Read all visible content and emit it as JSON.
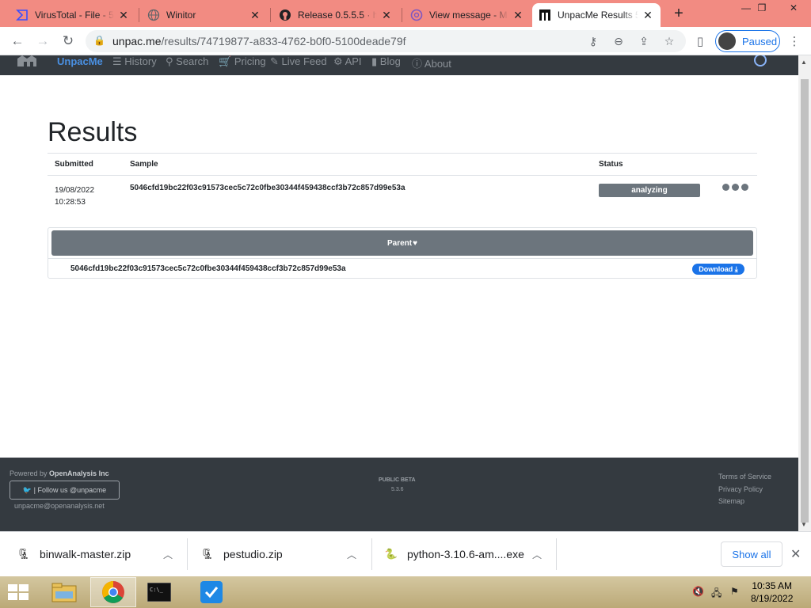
{
  "tabs": [
    {
      "title": "VirusTotal - File - 5",
      "icon": "virustotal-icon"
    },
    {
      "title": "Winitor",
      "icon": "globe-icon"
    },
    {
      "title": "Release 0.5.5.5 · ha",
      "icon": "github-icon"
    },
    {
      "title": "View message - M",
      "icon": "mail-icon"
    },
    {
      "title": "UnpacMe Results 5",
      "icon": "unpacme-icon",
      "active": true
    }
  ],
  "address": {
    "host": "unpac.me",
    "path": "/results/74719877-a833-4762-b0f0-5100deade79f"
  },
  "profile": {
    "label": "Paused"
  },
  "site_nav": {
    "brand": "UnpacMe",
    "links": [
      "History",
      "Search",
      "Pricing",
      "Live Feed",
      "API",
      "Blog",
      "About"
    ]
  },
  "page": {
    "title": "Results",
    "columns": {
      "submitted": "Submitted",
      "sample": "Sample",
      "status": "Status"
    },
    "row": {
      "date": "19/08/2022",
      "time": "10:28:53",
      "sample": "5046cfd19bc22f03c91573cec5c72c0fbe30344f459438ccf3b72c857d99e53a",
      "status": "analyzing"
    },
    "parent": {
      "label": "Parent",
      "hash": "5046cfd19bc22f03c91573cec5c72c0fbe30344f459438ccf3b72c857d99e53a",
      "download_label": "Download"
    }
  },
  "footer": {
    "powered_prefix": "Powered by",
    "powered_by": "OpenAnalysis Inc",
    "follow": "| Follow us @unpacme",
    "email": "unpacme@openanalysis.net",
    "beta": "PUBLIC BETA",
    "version": "5.3.6",
    "links": [
      "Terms of Service",
      "Privacy Policy",
      "Sitemap"
    ]
  },
  "downloads": {
    "items": [
      "binwalk-master.zip",
      "pestudio.zip",
      "python-3.10.6-am....exe"
    ],
    "show_all": "Show all"
  },
  "taskbar": {
    "time": "10:35 AM",
    "date": "8/19/2022"
  },
  "colors": {
    "tabstrip": "#f28b82",
    "nav": "#343a40",
    "badge": "#6c757d",
    "accent": "#1a73e8"
  }
}
